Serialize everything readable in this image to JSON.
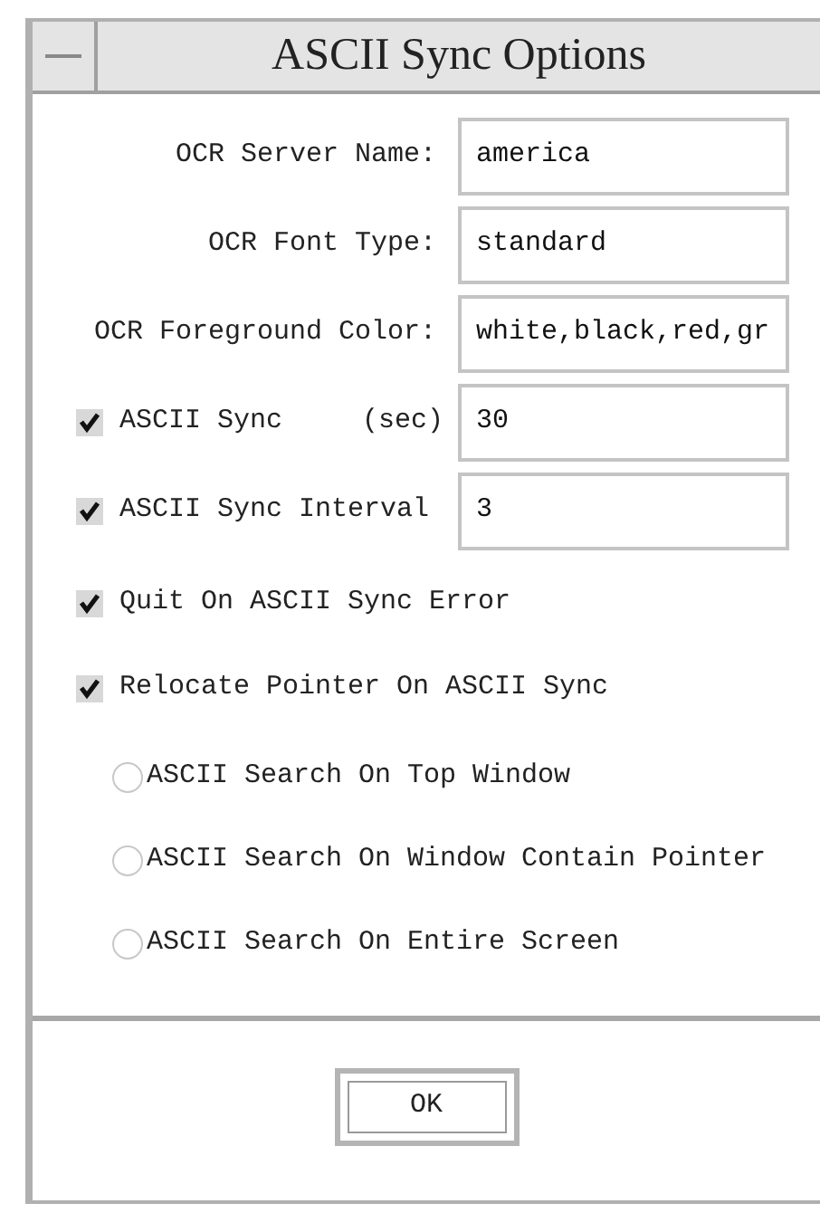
{
  "window": {
    "title": "ASCII Sync Options"
  },
  "rows": [
    {
      "kind": "field",
      "label": "OCR Server Name:",
      "value": "america"
    },
    {
      "kind": "field",
      "label": "OCR Font Type:",
      "value": "standard"
    },
    {
      "kind": "field",
      "label": "OCR Foreground Color:",
      "value": "white,black,red,gr"
    },
    {
      "kind": "check_field",
      "label": "ASCII Sync",
      "unit": "(sec)",
      "checked": true,
      "value": "30"
    },
    {
      "kind": "check_field",
      "label": "ASCII Sync Interval",
      "checked": true,
      "value": "3"
    },
    {
      "kind": "check",
      "label": "Quit On ASCII Sync Error",
      "checked": true
    },
    {
      "kind": "check",
      "label": "Relocate Pointer On ASCII Sync",
      "checked": true
    }
  ],
  "radios": [
    {
      "label": "ASCII Search On Top Window",
      "selected": false
    },
    {
      "label": "ASCII Search On Window Contain Pointer",
      "selected": false
    },
    {
      "label": "ASCII Search On Entire Screen",
      "selected": false
    }
  ],
  "buttons": [
    "OK"
  ]
}
